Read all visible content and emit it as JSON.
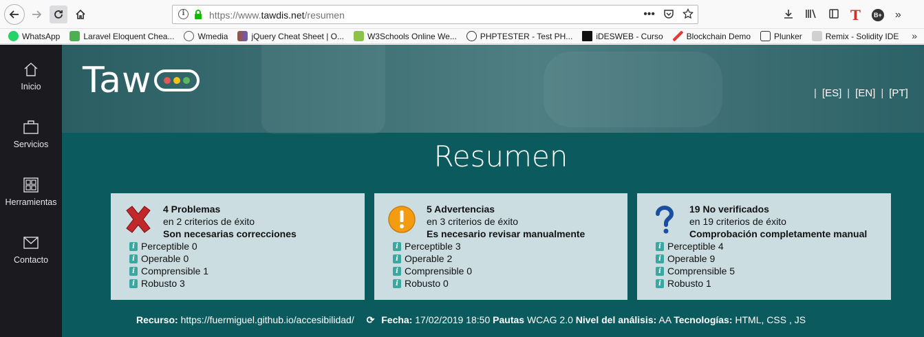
{
  "browser": {
    "url_prefix": "https://www.",
    "url_host": "tawdis.net",
    "url_path": "/resumen",
    "more_label": "•••"
  },
  "bookmarks": [
    {
      "label": "WhatsApp",
      "icon": "whatsapp-icon",
      "color": "#25d366"
    },
    {
      "label": "Laravel Eloquent Chea...",
      "icon": "laravel-icon",
      "color": "#4caf50"
    },
    {
      "label": "Wmedia",
      "icon": "globe-icon",
      "color": "#555555"
    },
    {
      "label": "jQuery Cheat Sheet | O...",
      "icon": "jquery-icon",
      "color": "#a0522d"
    },
    {
      "label": "W3Schools Online We...",
      "icon": "w3schools-icon",
      "color": "#8bc34a"
    },
    {
      "label": "PHPTESTER - Test PH...",
      "icon": "phptester-icon",
      "color": "#333333"
    },
    {
      "label": "iDESWEB - Curso",
      "icon": "ideweb-icon",
      "color": "#111111"
    },
    {
      "label": "Blockchain Demo",
      "icon": "blockchain-icon",
      "color": "#e53935"
    },
    {
      "label": "Plunker",
      "icon": "plunker-icon",
      "color": "#333333"
    },
    {
      "label": "Remix - Solidity IDE",
      "icon": "remix-icon",
      "color": "#9e9e9e"
    }
  ],
  "bookmarks_overflow": "»",
  "sidebar": {
    "items": [
      {
        "label": "Inicio",
        "icon": "home-icon"
      },
      {
        "label": "Servicios",
        "icon": "briefcase-icon"
      },
      {
        "label": "Herramientas",
        "icon": "grid-icon"
      },
      {
        "label": "Contacto",
        "icon": "envelope-icon"
      }
    ]
  },
  "header": {
    "logo_text": "Taw",
    "logo_dot_colors": [
      "#e05a5a",
      "#f0c419",
      "#5cb85c"
    ],
    "languages": [
      "[ES]",
      "[EN]",
      "[PT]"
    ]
  },
  "main": {
    "title": "Resumen",
    "cards": [
      {
        "count": "4 Problemas",
        "criteria": "en 2 criterios de éxito",
        "need": "Son necesarias correcciones",
        "icon": "error-x-icon",
        "items": [
          "Perceptible 0",
          "Operable 0",
          "Comprensible 1",
          "Robusto 3"
        ]
      },
      {
        "count": "5 Advertencias",
        "criteria": "en 3 criterios de éxito",
        "need": "Es necesario revisar manualmente",
        "icon": "warning-icon",
        "items": [
          "Perceptible 3",
          "Operable 2",
          "Comprensible 0",
          "Robusto 0"
        ]
      },
      {
        "count": "19 No verificados",
        "criteria": "en 19 criterios de éxito",
        "need": "Comprobación completamente manual",
        "icon": "question-icon",
        "items": [
          "Perceptible 4",
          "Operable 9",
          "Comprensible 5",
          "Robusto 1"
        ]
      }
    ]
  },
  "footer": {
    "resource_label": "Recurso:",
    "resource_value": "https://fuermiguel.github.io/accesibilidad/",
    "date_label": "Fecha:",
    "date_value": "17/02/2019 18:50",
    "guidelines_label": "Pautas",
    "guidelines_value": "WCAG 2.0",
    "level_label": "Nivel del análisis:",
    "level_value": "AA",
    "tech_label": "Tecnologías:",
    "tech_value": "HTML, CSS , JS"
  }
}
